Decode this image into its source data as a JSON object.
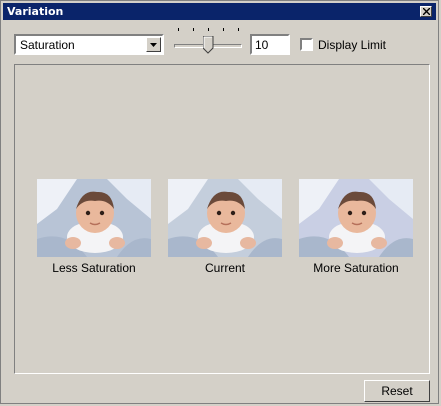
{
  "window": {
    "title": "Variation"
  },
  "toolbar": {
    "mode_select": {
      "selected": "Saturation"
    },
    "slider": {
      "level": 0.5,
      "tick_count": 5
    },
    "amount": "10",
    "display_limit": {
      "label": "Display Limit",
      "checked": false
    }
  },
  "variations": [
    {
      "caption": "Less Saturation",
      "tint": "#b8c4d6"
    },
    {
      "caption": "Current",
      "tint": "#c4cedc"
    },
    {
      "caption": "More Saturation",
      "tint": "#c9cfe4"
    }
  ],
  "buttons": {
    "reset": "Reset"
  },
  "icons": {
    "close": "close-icon",
    "dropdown": "chevron-down-icon"
  }
}
